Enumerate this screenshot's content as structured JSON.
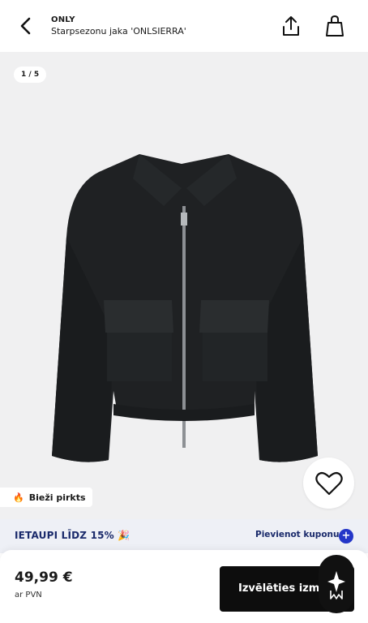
{
  "header": {
    "brand": "ONLY",
    "product_name": "Starpsezonu jaka 'ONLSIERRA'"
  },
  "gallery": {
    "counter": "1 / 5",
    "badge_label": "Bieži pirkts"
  },
  "promo": {
    "text": "IETAUPI LĪDZ 15% 🎉",
    "coupon_label": "Pievienot kuponu",
    "plus_symbol": "+"
  },
  "purchase": {
    "price": "49,99 €",
    "vat_note": "ar PVN",
    "select_size_label": "Izvēlēties izmē"
  },
  "colors": {
    "promo_bg": "#eef0f6",
    "promo_text": "#1a2a6b",
    "accent": "#2436c8",
    "button_bg": "#0d0d0d"
  },
  "icons": [
    "back-arrow-icon",
    "share-icon",
    "shopping-bag-icon",
    "heart-icon",
    "fire-icon",
    "assistant-icon"
  ]
}
